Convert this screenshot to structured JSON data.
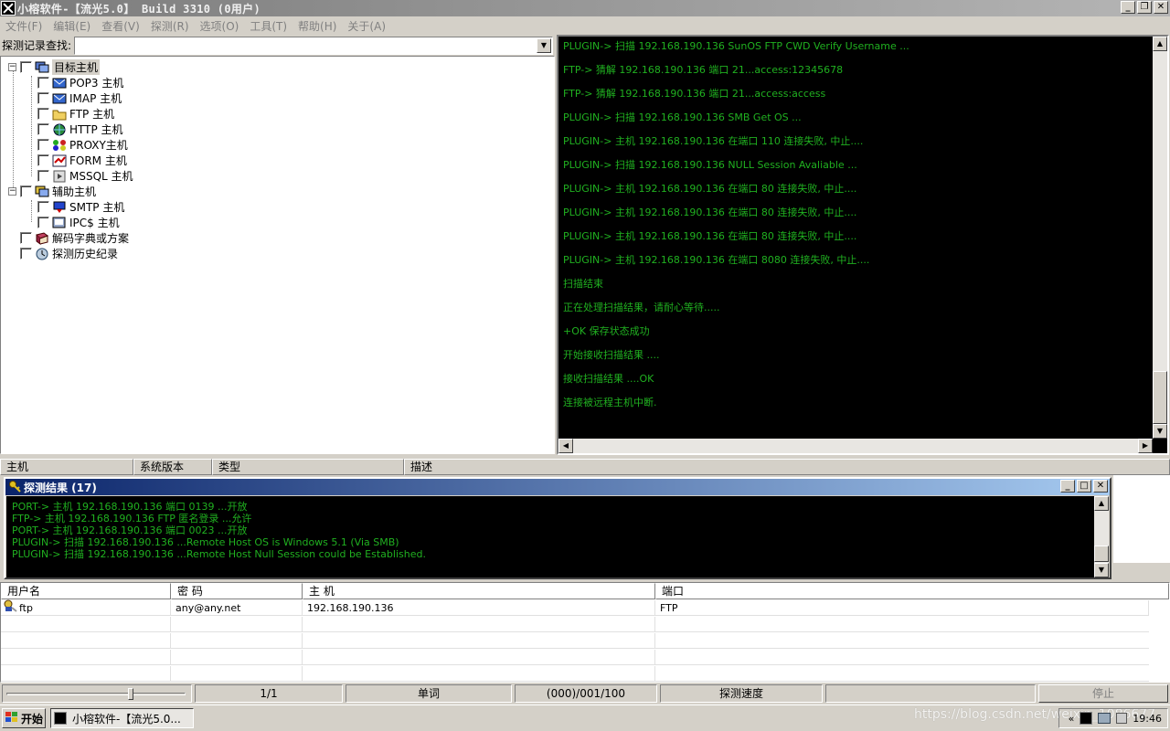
{
  "window": {
    "title": "小榕软件-【流光5.0】 Build 3310 (0用户)",
    "min_glyph": "_",
    "restore_glyph": "❐",
    "close_glyph": "✕"
  },
  "menu": [
    "文件(F)",
    "编辑(E)",
    "查看(V)",
    "探测(R)",
    "选项(O)",
    "工具(T)",
    "帮助(H)",
    "关于(A)"
  ],
  "search": {
    "label": "探测记录查找:",
    "value": ""
  },
  "tree": {
    "root1": "目标主机",
    "children1": [
      "POP3 主机",
      "IMAP 主机",
      "FTP  主机",
      "HTTP 主机",
      "PROXY主机",
      "FORM 主机",
      "MSSQL 主机"
    ],
    "root2": "辅助主机",
    "children2": [
      "SMTP 主机",
      "IPC$ 主机"
    ],
    "root3": "解码字典或方案",
    "root4": "探测历史纪录"
  },
  "console_lines": [
    "PLUGIN-> 扫描 192.168.190.136 SunOS FTP CWD Verify Username ...",
    "FTP-> 猜解 192.168.190.136 端口 21...access:12345678",
    "FTP-> 猜解 192.168.190.136 端口 21...access:access",
    "PLUGIN-> 扫描 192.168.190.136 SMB Get OS ...",
    "PLUGIN-> 主机 192.168.190.136 在端口 110 连接失败, 中止....",
    "PLUGIN-> 扫描 192.168.190.136 NULL Session Avaliable ...",
    "PLUGIN-> 主机 192.168.190.136 在端口 80 连接失败, 中止....",
    "PLUGIN-> 主机 192.168.190.136 在端口 80 连接失败, 中止....",
    "PLUGIN-> 主机 192.168.190.136 在端口 80 连接失败, 中止....",
    "PLUGIN-> 主机 192.168.190.136 在端口 8080 连接失败, 中止....",
    "扫描结束",
    "正在处理扫描结果，请耐心等待.....",
    "+OK 保存状态成功",
    "开始接收扫描结果 ....",
    "接收扫描结果 ....OK",
    "连接被远程主机中断."
  ],
  "host_table_headers": [
    "主机",
    "系统版本",
    "类型",
    "描述"
  ],
  "results": {
    "title": "探测结果 (17)",
    "lines": [
      "PORT-> 主机 192.168.190.136 端口 0139 ...开放",
      "FTP-> 主机 192.168.190.136 FTP 匿名登录 ...允许",
      "PORT-> 主机 192.168.190.136 端口 0023 ...开放",
      "PLUGIN-> 扫描 192.168.190.136 ...Remote Host OS is Windows 5.1 (Via SMB)",
      "PLUGIN-> 扫描 192.168.190.136 ...Remote Host Null Session could be Established."
    ]
  },
  "cred_table": {
    "headers": [
      "用户名",
      "密 码",
      "主 机",
      "端口"
    ],
    "rows": [
      {
        "user": "ftp",
        "password": "any@any.net",
        "host": "192.168.190.136",
        "port": "FTP"
      }
    ]
  },
  "statusbar": {
    "page": "1/1",
    "mode": "单词",
    "progress": "(000)/001/100",
    "speed_label": "探测速度",
    "stop_label": "停止",
    "slider_level": 0.7
  },
  "taskbar": {
    "start": "开始",
    "item": "小榕软件-【流光5.0...",
    "clock": "19:46",
    "chevron": "«",
    "watermark": "https://blog.csdn.net/weixin_1086677"
  }
}
